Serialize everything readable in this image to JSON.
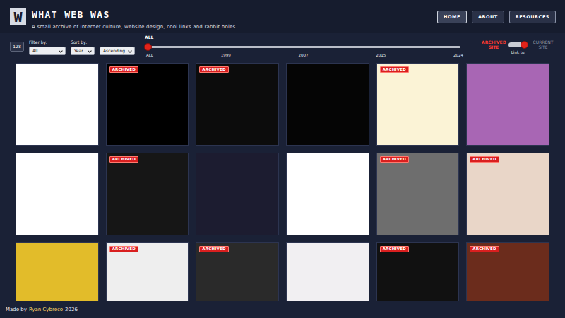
{
  "header": {
    "logo": "W",
    "title": "WHAT WEB WAS",
    "subtitle": "A small archive of internet culture, website design, cool links and rabbit holes"
  },
  "nav": [
    {
      "label": "HOME",
      "selected": true
    },
    {
      "label": "ABOUT",
      "selected": false
    },
    {
      "label": "RESOURCES",
      "selected": false
    }
  ],
  "controls": {
    "count": "128",
    "filter": {
      "label": "Filter by:",
      "value": "All"
    },
    "sort": {
      "label": "Sort by:",
      "value": "Year"
    },
    "order": {
      "value": "Ascending"
    }
  },
  "timeline": {
    "value_label": "ALL",
    "level": 0,
    "ticks": [
      "ALL",
      "1999",
      "2007",
      "2015",
      "2024"
    ]
  },
  "link_toggle": {
    "label": "Link to:",
    "options": [
      {
        "label": "ARCHIVED SITE",
        "selected": true
      },
      {
        "label": "CURRENT SITE",
        "selected": false
      }
    ]
  },
  "badge": "ARCHIVED",
  "cards": [
    {
      "archived": false,
      "color": "#ffffff"
    },
    {
      "archived": true,
      "color": "#000000"
    },
    {
      "archived": true,
      "color": "#0c0c0c"
    },
    {
      "archived": false,
      "color": "#050505"
    },
    {
      "archived": true,
      "color": "#fbf3d6"
    },
    {
      "archived": false,
      "color": "#a866b4"
    },
    {
      "archived": false,
      "color": "#ffffff"
    },
    {
      "archived": true,
      "color": "#161616"
    },
    {
      "archived": false,
      "color": "#1c1c30"
    },
    {
      "archived": false,
      "color": "#ffffff"
    },
    {
      "archived": true,
      "color": "#6e6e6e"
    },
    {
      "archived": true,
      "color": "#e9d6c8"
    },
    {
      "archived": false,
      "color": "#e2bc2a"
    },
    {
      "archived": true,
      "color": "#eeeeee"
    },
    {
      "archived": true,
      "color": "#2a2a2a"
    },
    {
      "archived": false,
      "color": "#f1eff2"
    },
    {
      "archived": true,
      "color": "#111111"
    },
    {
      "archived": true,
      "color": "#6b2c1c"
    }
  ],
  "footer": {
    "prefix": "Made by",
    "author": "Ryan Cybreco",
    "suffix": "2026"
  }
}
